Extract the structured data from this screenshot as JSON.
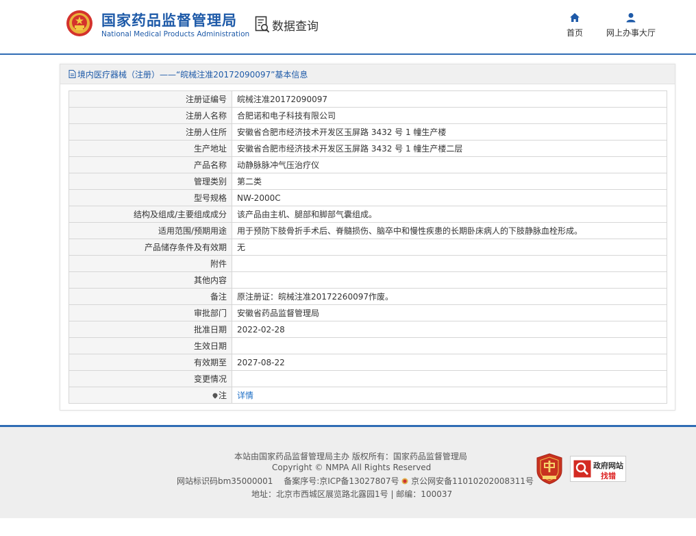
{
  "header": {
    "brand_cn": "国家药品监督管理局",
    "brand_en": "National Medical Products Administration",
    "query_label": "数据查询",
    "nav": [
      {
        "label": "首页",
        "icon": "home-icon"
      },
      {
        "label": "网上办事大厅",
        "icon": "user-icon"
      }
    ]
  },
  "panel": {
    "title": "境内医疗器械（注册）——“皖械注准20172090097”基本信息",
    "rows": [
      {
        "label": "注册证编号",
        "value": "皖械注准20172090097"
      },
      {
        "label": "注册人名称",
        "value": "合肥诺和电子科技有限公司"
      },
      {
        "label": "注册人住所",
        "value": "安徽省合肥市经济技术开发区玉屏路 3432 号 1 幢生产楼"
      },
      {
        "label": "生产地址",
        "value": "安徽省合肥市经济技术开发区玉屏路 3432 号 1 幢生产楼二层"
      },
      {
        "label": "产品名称",
        "value": "动静脉脉冲气压治疗仪"
      },
      {
        "label": "管理类别",
        "value": "第二类"
      },
      {
        "label": "型号规格",
        "value": "NW-2000C"
      },
      {
        "label": "结构及组成/主要组成成分",
        "value": "该产品由主机、腿部和脚部气囊组成。"
      },
      {
        "label": "适用范围/预期用途",
        "value": "用于预防下肢骨折手术后、脊髓损伤、脑卒中和慢性疾患的长期卧床病人的下肢静脉血栓形成。"
      },
      {
        "label": "产品储存条件及有效期",
        "value": "无"
      },
      {
        "label": "附件",
        "value": ""
      },
      {
        "label": "其他内容",
        "value": ""
      },
      {
        "label": "备注",
        "value": "原注册证：皖械注准20172260097作废。"
      },
      {
        "label": "审批部门",
        "value": "安徽省药品监督管理局"
      },
      {
        "label": "批准日期",
        "value": "2022-02-28"
      },
      {
        "label": "生效日期",
        "value": ""
      },
      {
        "label": "有效期至",
        "value": "2027-08-22"
      },
      {
        "label": "变更情况",
        "value": ""
      }
    ],
    "note_row": {
      "label": "注",
      "link": "详情"
    }
  },
  "footer": {
    "line1": "本站由国家药品监督管理局主办 版权所有：国家药品监督管理局",
    "line2": "Copyright © NMPA All Rights Reserved",
    "line3a": "网站标识码bm35000001　 备案序号:京ICP备13027807号",
    "line3b": "京公网安备11010202008311号",
    "line4": "地址：北京市西城区展览路北露园1号 | 邮编：100037",
    "gov_badge_text": "党政机关",
    "fix_line1": "政府网站",
    "fix_line2": "找错"
  },
  "colors": {
    "brand_blue": "#1e5aa8",
    "accent_line": "#2f6cb4",
    "link": "#1e6fc6"
  }
}
